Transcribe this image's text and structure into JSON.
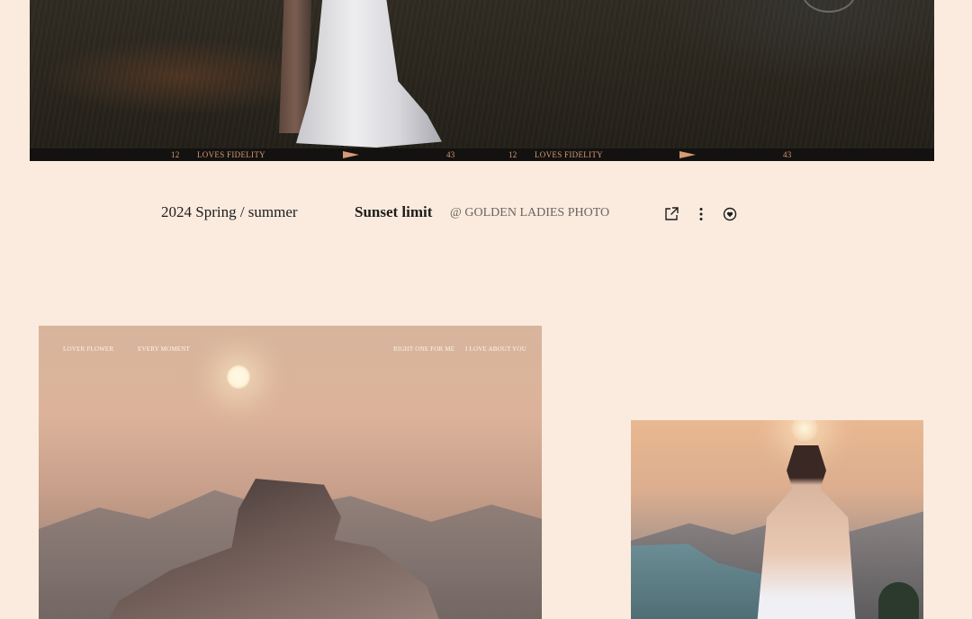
{
  "hero_photo": {
    "filmstrip": [
      {
        "text": "12"
      },
      {
        "text": "LOVES FIDELITY"
      },
      {
        "text": "43"
      },
      {
        "text": "12"
      },
      {
        "text": "LOVES FIDELITY"
      },
      {
        "text": "43"
      }
    ]
  },
  "caption": {
    "season": "2024 Spring / summer",
    "title": "Sunset limit",
    "credit": "@ GOLDEN LADIES PHOTO",
    "icons": [
      "share-icon",
      "more-vertical-icon",
      "heart-icon"
    ]
  },
  "photo_left": {
    "overlay": {
      "t1": "LOVER FLOWER",
      "t2": "EVERY MOMENT",
      "t3": "RIGHT ONE FOR ME",
      "t4": "I LOVE ABOUT YOU"
    }
  },
  "colors": {
    "background": "#fbebde",
    "filmstrip_text": "#d79a76",
    "text": "#1c1c1c"
  }
}
